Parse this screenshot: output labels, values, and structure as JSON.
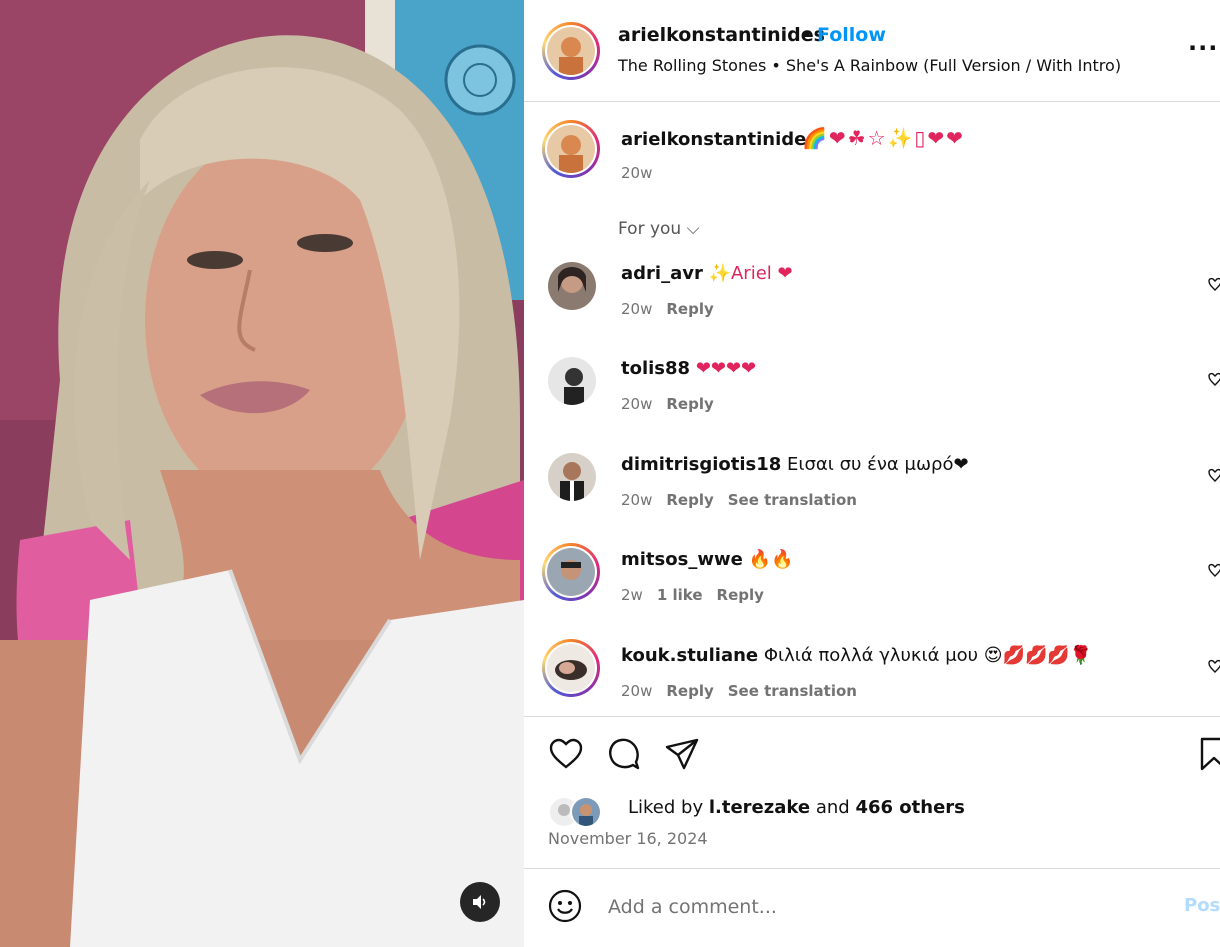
{
  "header": {
    "username": "arielkonstantinides",
    "separator": "•",
    "follow_label": "Follow",
    "audio": "The Rolling Stones • She's A Rainbow (Full Version / With Intro)",
    "more_label": "..."
  },
  "caption": {
    "username": "arielkonstantinides",
    "emojis": "🌈❤☘☆✨▯❤❤",
    "time": "20w"
  },
  "for_you_label": "For you ⌵",
  "comments": [
    {
      "username": "adri_avr",
      "text": "✨Ariel ❤",
      "time": "20w",
      "likes": "",
      "reply": "Reply",
      "translation": ""
    },
    {
      "username": "tolis88",
      "text": "❤❤❤❤",
      "time": "20w",
      "likes": "",
      "reply": "Reply",
      "translation": ""
    },
    {
      "username": "dimitrisgiotis18",
      "text": "Εισαι συ ένα μωρό❤",
      "time": "20w",
      "likes": "",
      "reply": "Reply",
      "translation": "See translation"
    },
    {
      "username": "mitsos_wwe",
      "text": "🔥🔥",
      "time": "2w",
      "likes": "1 like",
      "reply": "Reply",
      "translation": ""
    },
    {
      "username": "kouk.stuliane",
      "text": "Φιλιά πολλά γλυκιά μου 😍💋💋💋🌹",
      "time": "20w",
      "likes": "",
      "reply": "Reply",
      "translation": "See translation"
    }
  ],
  "likes": {
    "prefix": "Liked by",
    "user": "l.terezake",
    "middle": "and",
    "others": "466 others"
  },
  "date": "November 16, 2024",
  "comment_box": {
    "placeholder": "Add a comment...",
    "post_label": "Post"
  },
  "icons": [
    "sound-icon",
    "heart-icon",
    "comment-icon",
    "share-icon",
    "bookmark-icon",
    "emoji-icon",
    "more-icon"
  ],
  "colors": {
    "accent": "#0095f6",
    "meta": "#737373",
    "post_disabled": "#b3dbff"
  }
}
